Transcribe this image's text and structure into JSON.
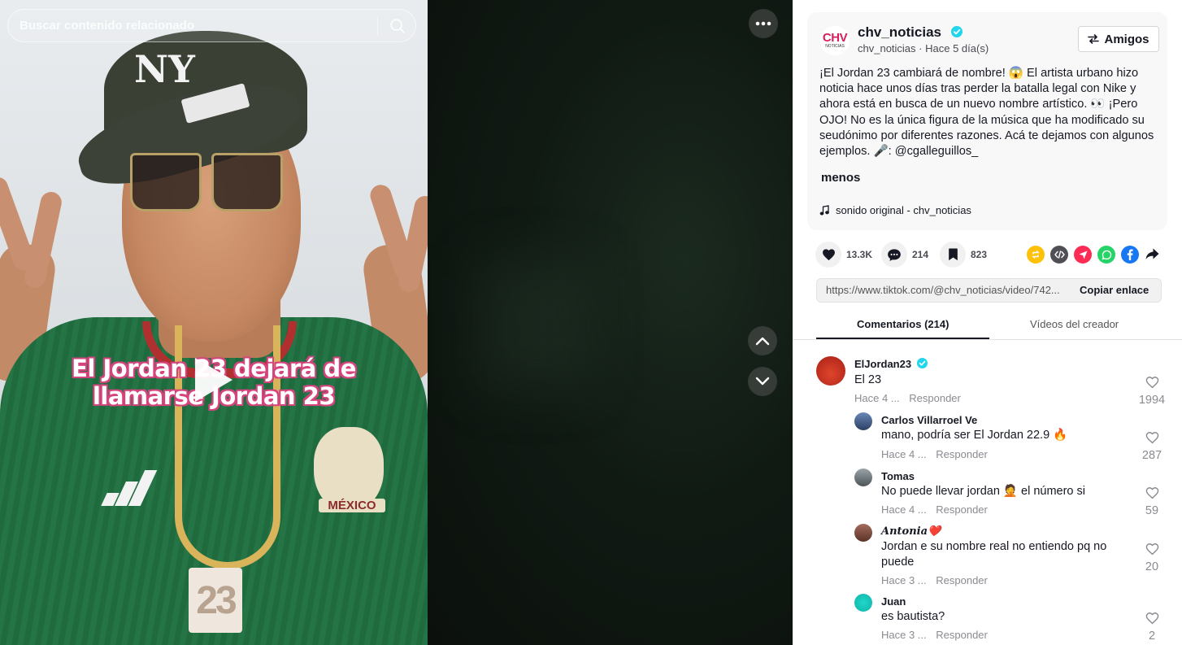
{
  "search": {
    "placeholder": "Buscar contenido relacionado"
  },
  "video": {
    "overlay_line1": "El Jordan 23 dejará de",
    "overlay_line2": "llamarse Jordan 23",
    "shirt_crest_text": "MÉXICO",
    "pendant_text": "23",
    "cap_logo": "NY"
  },
  "post": {
    "avatar_text": "CHV",
    "avatar_subtext": "NOTICIAS",
    "author": "chv_noticias",
    "author_handle": "chv_noticias",
    "posted": "Hace 5 día(s)",
    "friends_label": "Amigos",
    "description": "¡El Jordan 23 cambiará de nombre! 😱 El artista urbano hizo noticia hace unos días tras perder la batalla legal con Nike y ahora está en busca de un nuevo nombre artístico. 👀 ¡Pero OJO! No es la única figura de la música que ha modificado su seudónimo por diferentes razones. Acá te dejamos con algunos ejemplos. 🎤: @cgalleguillos_",
    "less_label": "menos",
    "music": "sonido original - chv_noticias"
  },
  "stats": {
    "likes": "13.3K",
    "comments": "214",
    "saves": "823"
  },
  "link": {
    "url": "https://www.tiktok.com/@chv_noticias/video/742...",
    "copy_label": "Copiar enlace"
  },
  "tabs": {
    "comments": "Comentarios (214)",
    "videos": "Vídeos del creador"
  },
  "comments": [
    {
      "author": "ElJordan23",
      "text": "El 23",
      "time": "Hace 4 ...",
      "reply": "Responder",
      "likes": "1994",
      "verified": true
    },
    {
      "author": "Carlos Villarroel Ve",
      "text": "mano, podría ser El Jordan 22.9 🔥",
      "time": "Hace 4 ...",
      "reply": "Responder",
      "likes": "287"
    },
    {
      "author": "Tomas",
      "text": "No puede llevar jordan 🤦 el número si",
      "time": "Hace 4 ...",
      "reply": "Responder",
      "likes": "59"
    },
    {
      "author": "𝑨𝒏𝒕𝒐𝒏𝒊𝒂❤️",
      "text": "Jordan e su nombre real no entiendo pq no puede",
      "time": "Hace 3 ...",
      "reply": "Responder",
      "likes": "20"
    },
    {
      "author": "Juan",
      "text": "es bautista?",
      "time": "Hace 3 ...",
      "reply": "Responder",
      "likes": "2"
    }
  ],
  "colors": {
    "accent": "#fe2c55",
    "verified": "#20d5ec",
    "overlay_outline": "#d6457f",
    "repost": "#ffc107",
    "whatsapp": "#25d366",
    "facebook": "#1877f2"
  }
}
